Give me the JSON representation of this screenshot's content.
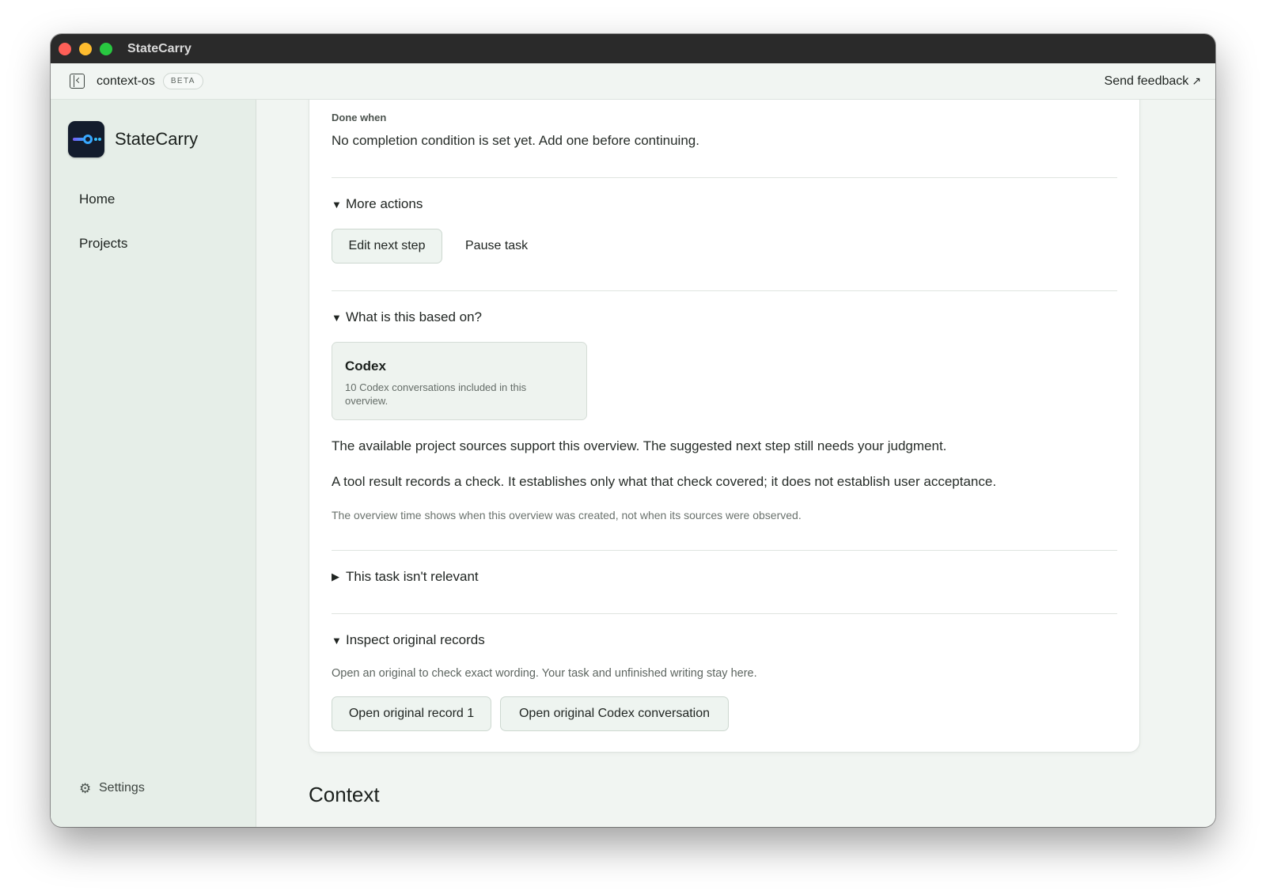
{
  "window": {
    "title": "StateCarry"
  },
  "topbar": {
    "workspace": "context-os",
    "badge": "BETA",
    "feedback": "Send feedback",
    "feedback_icon": "↗"
  },
  "sidebar": {
    "brand": "StateCarry",
    "items": [
      {
        "label": "Home"
      },
      {
        "label": "Projects"
      }
    ],
    "settings": "Settings"
  },
  "card": {
    "done_when": {
      "label": "Done when",
      "text": "No completion condition is set yet. Add one before continuing."
    },
    "more_actions": {
      "caret": "▼",
      "label": "More actions",
      "edit_button": "Edit next step",
      "pause_button": "Pause task"
    },
    "based_on": {
      "caret": "▼",
      "label": "What is this based on?",
      "source": {
        "title": "Codex",
        "description": "10 Codex conversations included in this overview."
      },
      "paragraphs": [
        "The available project sources support this overview. The suggested next step still needs your judgment.",
        "A tool result records a check. It establishes only what that check covered; it does not establish user acceptance.",
        "The overview time shows when this overview was created, not when its sources were observed."
      ]
    },
    "not_relevant": {
      "caret": "▶",
      "label": "This task isn't relevant"
    },
    "inspect": {
      "caret": "▼",
      "label": "Inspect original records",
      "description": "Open an original to check exact wording. Your task and unfinished writing stay here.",
      "buttons": [
        "Open original record 1",
        "Open original Codex conversation"
      ]
    }
  },
  "context_heading": "Context",
  "icons": {
    "sidebar_toggle": "sidebar-toggle-icon",
    "logo": "statecarry-logo-icon",
    "settings": "gear-icon",
    "feedback": "external-arrow-icon"
  }
}
